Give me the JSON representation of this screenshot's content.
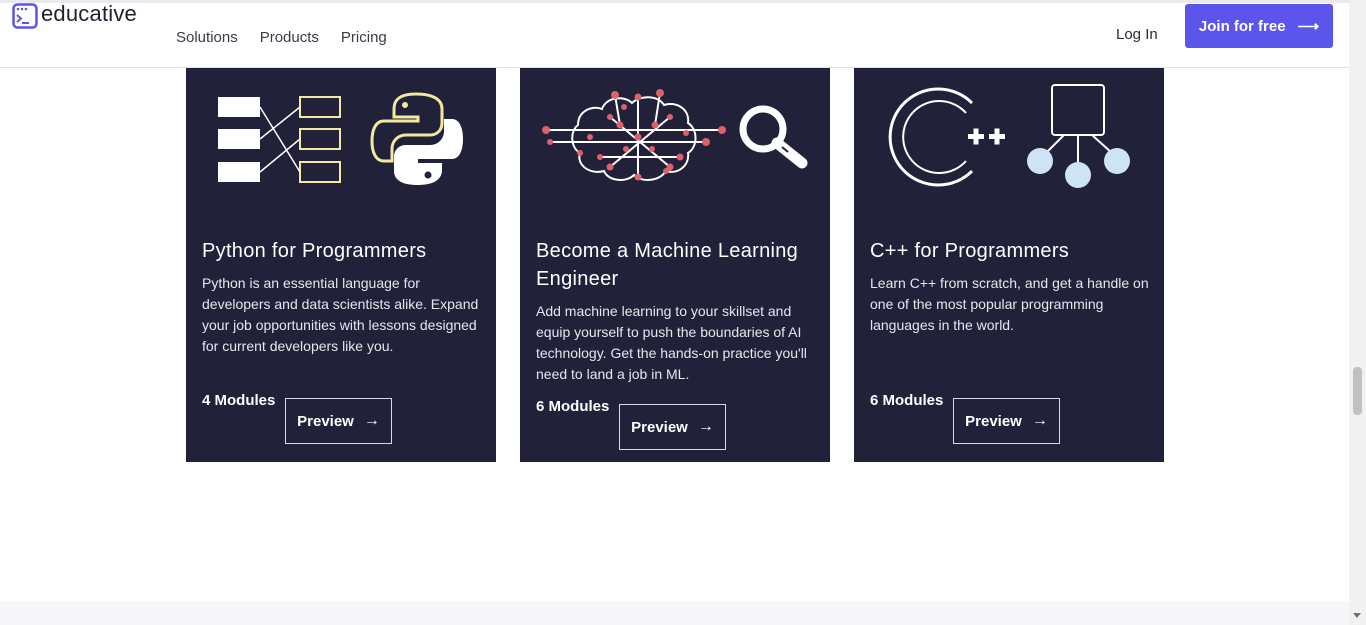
{
  "brand": {
    "name": "educative",
    "logo_icon": "terminal-window-icon",
    "accent": "#5c55eb"
  },
  "nav": {
    "items": [
      "Solutions",
      "Products",
      "Pricing"
    ]
  },
  "header": {
    "login_label": "Log In",
    "join_label": "Join for free",
    "join_icon": "arrow-right-icon"
  },
  "cards": [
    {
      "title": "Python for Programmers",
      "description": "Python is an essential language for developers and data scientists alike. Expand your job opportunities with lessons designed for current developers like you.",
      "modules": "4 Modules",
      "preview_label": "Preview",
      "art": [
        "list-mapping-icon",
        "python-logo-icon"
      ]
    },
    {
      "title": "Become a Machine Learning Engineer",
      "description": "Add machine learning to your skillset and equip yourself to push the boundaries of AI technology. Get the hands-on practice you'll need to land a job in ML.",
      "modules": "6 Modules",
      "preview_label": "Preview",
      "art": [
        "neural-brain-icon",
        "magnifier-icon"
      ]
    },
    {
      "title": "C++ for Programmers",
      "description": "Learn C++ from scratch, and get a handle on one of the most popular programming languages in the world.",
      "modules": "6 Modules",
      "preview_label": "Preview",
      "art": [
        "cpp-logo-icon",
        "tree-diagram-icon"
      ]
    }
  ],
  "colors": {
    "card_bg": "#21213a",
    "python_yellow": "#f3e9a0",
    "neuron_red": "#e0606a",
    "node_blue": "#cfe3f7"
  }
}
